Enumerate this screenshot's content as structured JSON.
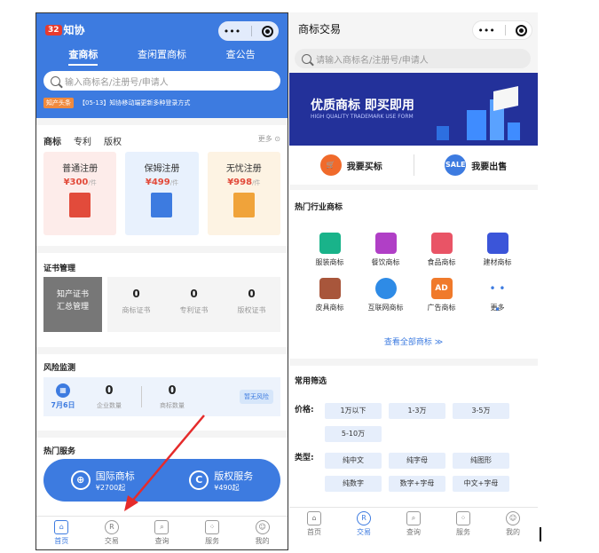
{
  "left": {
    "logo_badge": "32",
    "logo_text": "知协",
    "capsule_dots": "•••",
    "tabs": [
      "查商标",
      "查闲置商标",
      "查公告"
    ],
    "search_placeholder": "输入商标名/注册号/申请人",
    "news_tag": "知产头条",
    "news_text": "【05-13】知协移动端更新多种登录方式",
    "service_tabs": [
      "商标",
      "专利",
      "版权"
    ],
    "more": "更多",
    "services": [
      {
        "name": "普通注册",
        "price": "¥300",
        "unit": "/件",
        "color": "#fdecea",
        "icon_color": "#e24b3b"
      },
      {
        "name": "保姆注册",
        "price": "¥499",
        "unit": "/件",
        "color": "#e8f1fd",
        "icon_color": "#3d7be0"
      },
      {
        "name": "无忧注册",
        "price": "¥998",
        "unit": "/件",
        "color": "#fdf3e3",
        "icon_color": "#f0a33a"
      }
    ],
    "cert_title": "证书管理",
    "cert_box_line1": "知产证书",
    "cert_box_line2": "汇总管理",
    "cert_stats": [
      {
        "num": "0",
        "label": "商标证书"
      },
      {
        "num": "0",
        "label": "专利证书"
      },
      {
        "num": "0",
        "label": "版权证书"
      }
    ],
    "risk_title": "风险监测",
    "risk_date": "7月6日",
    "risk_stats": [
      {
        "num": "0",
        "label": "企业数量"
      },
      {
        "num": "0",
        "label": "商标数量"
      }
    ],
    "risk_status": "暂无风险",
    "hot_title": "热门服务",
    "hot_services": [
      {
        "icon": "globe-icon",
        "name": "国际商标",
        "price": "¥2700起"
      },
      {
        "icon": "copyright-icon",
        "name": "版权服务",
        "price": "¥490起"
      }
    ],
    "tabbar": [
      "首页",
      "交易",
      "查询",
      "服务",
      "我的"
    ]
  },
  "right": {
    "title": "商标交易",
    "capsule_dots": "•••",
    "search_placeholder": "请输入商标名/注册号/申请人",
    "banner_title": "优质商标 即买即用",
    "banner_sub": "HIGH QUALITY TRADEMARK USE FORM",
    "buy": "我要买标",
    "sell": "我要出售",
    "sell_badge": "SALE",
    "industry_title": "热门行业商标",
    "industries": [
      {
        "name": "服装商标",
        "color": "#19b38a"
      },
      {
        "name": "餐饮商标",
        "color": "#b03fc6"
      },
      {
        "name": "食品商标",
        "color": "#e95466"
      },
      {
        "name": "建材商标",
        "color": "#3b55d9"
      },
      {
        "name": "皮具商标",
        "color": "#a8563b"
      },
      {
        "name": "互联网商标",
        "color": "#2e8be6"
      },
      {
        "name": "广告商标",
        "color": "#f07a2b"
      },
      {
        "name": "更多",
        "color": "#3d7be0"
      }
    ],
    "ad_text": "AD",
    "more_dots": "• • •",
    "view_all": "查看全部商标 ≫",
    "filter_title": "常用筛选",
    "price_label": "价格:",
    "price_chips": [
      "1万以下",
      "1-3万",
      "3-5万",
      "5-10万"
    ],
    "type_label": "类型:",
    "type_chips": [
      "纯中文",
      "纯字母",
      "纯图形",
      "纯数字",
      "数字+字母",
      "中文+字母"
    ],
    "tabbar": [
      "首页",
      "交易",
      "查询",
      "服务",
      "我的"
    ]
  }
}
